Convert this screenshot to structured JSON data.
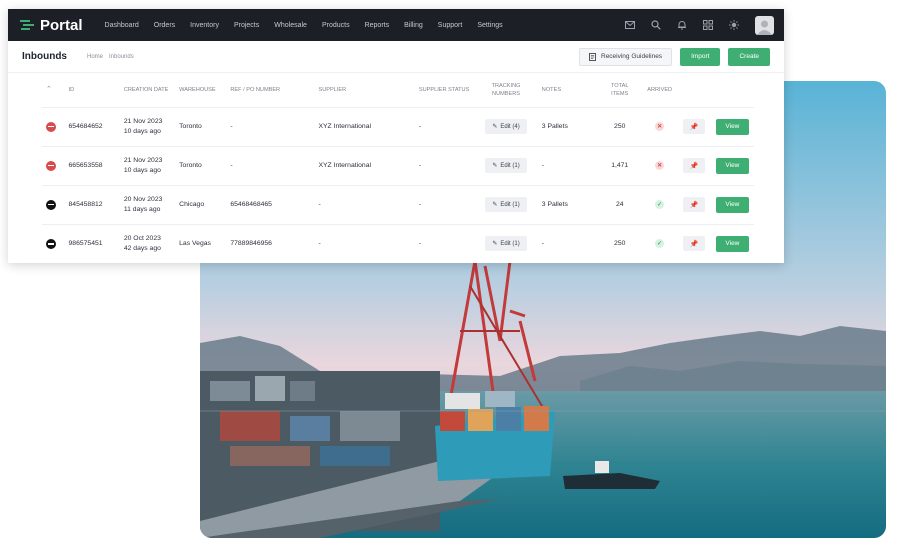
{
  "colors": {
    "accent": "#3fae72",
    "navbar": "#1d1f26",
    "danger": "#d94a4a",
    "neutral": "#111111"
  },
  "app": {
    "logo": "Portal",
    "nav": [
      "Dashboard",
      "Orders",
      "Inventory",
      "Projects",
      "Wholesale",
      "Products",
      "Reports",
      "Billing",
      "Support",
      "Settings"
    ],
    "nav_icons": [
      "mail-icon",
      "search-icon",
      "bell-icon",
      "grid-icon",
      "sun-icon"
    ]
  },
  "subheader": {
    "title": "Inbounds",
    "breadcrumb": [
      "Home",
      "Inbounds"
    ],
    "guidelines_label": "Receiving Guidelines",
    "import_label": "Import",
    "create_label": "Create"
  },
  "table": {
    "headers": {
      "id": "ID",
      "creation_date": "CREATION DATE",
      "warehouse": "WAREHOUSE",
      "ref": "REF / PO NUMBER",
      "supplier": "SUPPLIER",
      "supplier_status": "SUPPLIER STATUS",
      "tracking": "TRACKING NUMBERS",
      "notes": "NOTES",
      "total_items": "TOTAL ITEMS",
      "arrived": "ARRIVED"
    },
    "rows": [
      {
        "status": "red",
        "id": "654684652",
        "date": "21 Nov 2023",
        "ago": "10 days ago",
        "warehouse": "Toronto",
        "ref": "-",
        "supplier": "XYZ International",
        "supplier_status": "-",
        "tracking": "Edit (4)",
        "notes": "3 Pallets",
        "total": "250",
        "arrived": "no",
        "view": "View"
      },
      {
        "status": "red",
        "id": "665653558",
        "date": "21 Nov 2023",
        "ago": "10 days ago",
        "warehouse": "Toronto",
        "ref": "-",
        "supplier": "XYZ International",
        "supplier_status": "-",
        "tracking": "Edit (1)",
        "notes": "-",
        "total": "1,471",
        "arrived": "no",
        "view": "View"
      },
      {
        "status": "black",
        "id": "845458812",
        "date": "20 Nov 2023",
        "ago": "11 days ago",
        "warehouse": "Chicago",
        "ref": "65468468465",
        "supplier": "-",
        "supplier_status": "-",
        "tracking": "Edit (1)",
        "notes": "3 Pallets",
        "total": "24",
        "arrived": "yes",
        "view": "View"
      },
      {
        "status": "black",
        "id": "986575451",
        "date": "20 Oct 2023",
        "ago": "42 days ago",
        "warehouse": "Las Vegas",
        "ref": "77889846956",
        "supplier": "-",
        "supplier_status": "-",
        "tracking": "Edit (1)",
        "notes": "-",
        "total": "250",
        "arrived": "yes",
        "view": "View"
      }
    ]
  }
}
